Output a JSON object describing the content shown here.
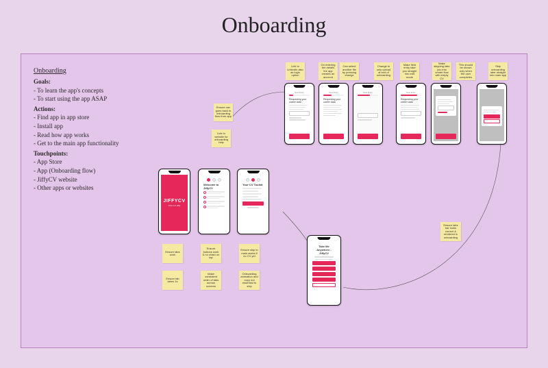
{
  "title": "Onboarding",
  "panel": {
    "heading": "Onboarding",
    "goals_label": "Goals:",
    "goals": [
      "- To learn the app's concepts",
      "- To start using the app ASAP"
    ],
    "actions_label": "Actions:",
    "actions": [
      "- Find app in app store",
      "- Install app",
      "- Read how app works",
      "- Get to the main app functionality"
    ],
    "touchpoints_label": "Touchpoints:",
    "touchpoints": [
      "- App Store",
      "- App (Onboarding flow)",
      "- JiffyCV website",
      "- Other apps or websites"
    ]
  },
  "stickies": {
    "s_top1": "Link to LinkedIn also as login option",
    "s_top2": "On entering the details the app creates an account",
    "s_top3": "Can select another file by pressing change",
    "s_top4": "Change to only upload at end of onboarding",
    "s_top5": "Make field entry take you straight into edit mode",
    "s_top6": "Make skipping take you into create flow with empty CV",
    "s_top7": "This should be shown only when the user completes",
    "s_top8": "Skip onboarding later straight into main app",
    "s_mid1": "Ensure nav goes back to onboarding flow from app",
    "s_mid2": "Link to website for onboarding help",
    "s_bot1": "Ensure tabs work",
    "s_bot2": "Ensure buttons work & no crash on tap",
    "s_bot3": "Ensure skip to main works if no CV yet",
    "s_bot4": "Ensure tab takes 1s",
    "s_bot5": "Make consistent order of tabs across screens",
    "s_bot6": "Onboarding animation and copy not essential to ship",
    "s_bot7": "Ensure tabs bar looks correct & rendered in onboarding"
  },
  "phones": {
    "brand": {
      "name": "JIFFYCV",
      "tagline": "CVs In A Jiffy"
    },
    "onb1_title": "Welcome to JiffyCV",
    "onb2_title": "Your CV Toolkit",
    "wizard_head": "New Entry",
    "wiz_title": "Requesting your career data",
    "menu_title": "Take Me Anywhere - JiffyCV"
  }
}
